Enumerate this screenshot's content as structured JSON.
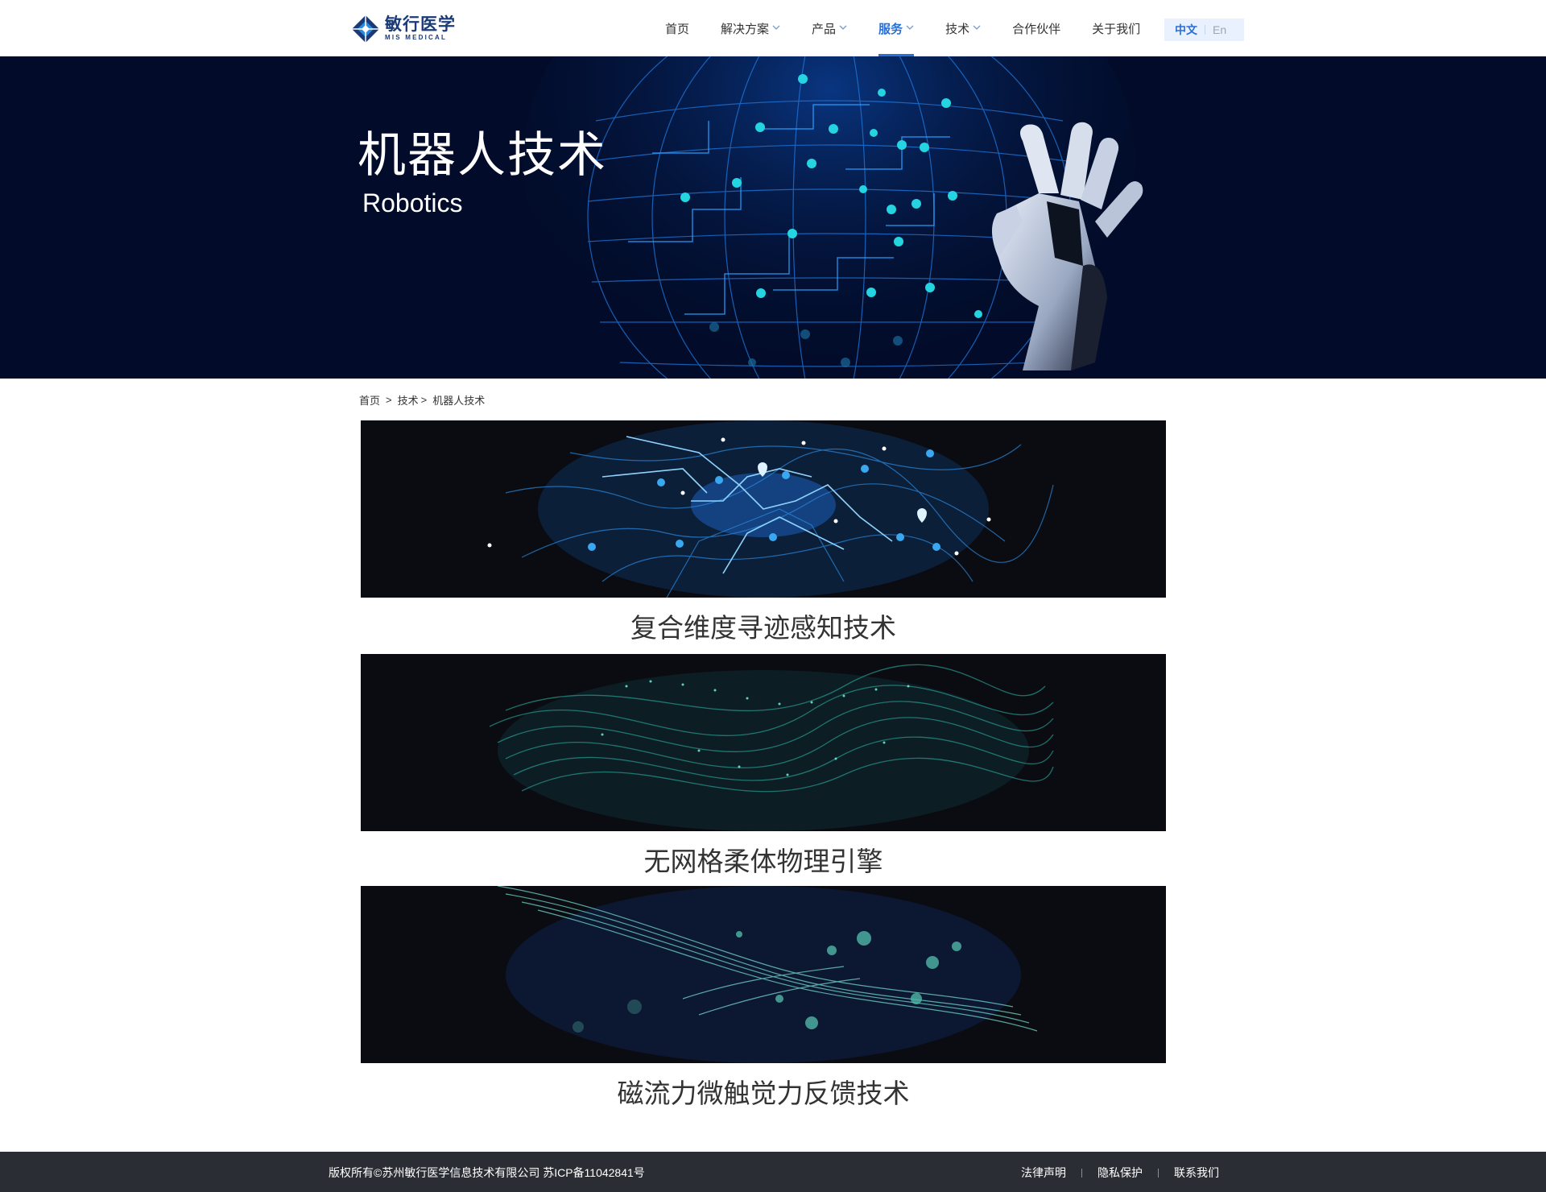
{
  "header": {
    "logo_cn": "敏行医学",
    "logo_en": "MIS MEDICAL",
    "nav": [
      {
        "label": "首页"
      },
      {
        "label": "解决方案"
      },
      {
        "label": "产品"
      },
      {
        "label": "服务"
      },
      {
        "label": "技术"
      },
      {
        "label": "合作伙伴"
      },
      {
        "label": "关于我们"
      }
    ],
    "lang_cn": "中文",
    "lang_en": "En"
  },
  "banner": {
    "title": "机器人技术",
    "subtitle": "Robotics"
  },
  "breadcrumb": {
    "home": "首页",
    "sep1": ">",
    "tech": "技术",
    "sep2": ">",
    "current": "机器人技术"
  },
  "cards": [
    {
      "title": "复合维度寻迹感知技术"
    },
    {
      "title": "无网格柔体物理引擎"
    },
    {
      "title": "磁流力微触觉力反馈技术"
    }
  ],
  "footer": {
    "copyright": "版权所有©苏州敏行医学信息技术有限公司  苏ICP备11042841号",
    "links": [
      "法律声明",
      "隐私保护",
      "联系我们"
    ]
  },
  "colors": {
    "accent": "#2a6fd6",
    "banner_bg": "#020c2a",
    "footer_bg": "#2a2d33"
  }
}
